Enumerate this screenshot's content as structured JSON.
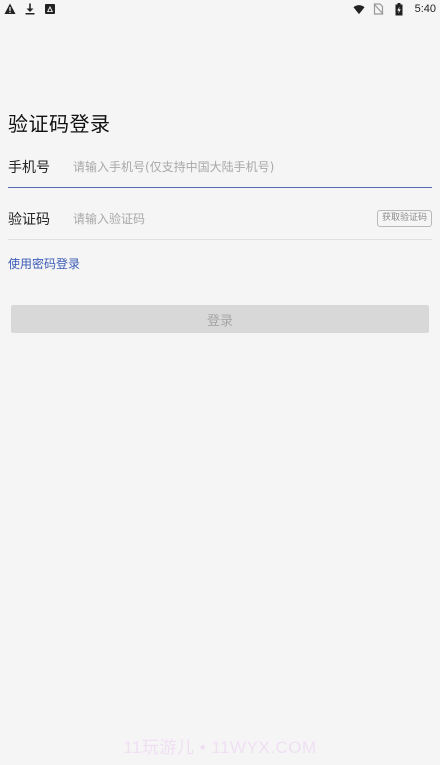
{
  "status_bar": {
    "left_icons": [
      "warning-icon",
      "download-icon",
      "app-notification-icon"
    ],
    "right_icons": [
      "wifi-icon",
      "no-sim-icon",
      "battery-icon"
    ],
    "time": "5:40"
  },
  "title": "验证码登录",
  "phone": {
    "label": "手机号",
    "placeholder": "请输入手机号(仅支持中国大陆手机号)",
    "value": ""
  },
  "code": {
    "label": "验证码",
    "placeholder": "请输入验证码",
    "value": "",
    "get_code_label": "获取验证码"
  },
  "password_login_link": "使用密码登录",
  "login_button": "登录",
  "watermark": "11玩游儿 • 11WYX.COM",
  "colors": {
    "background": "#f5f5f5",
    "link": "#3a5bb8",
    "active_underline": "#5467b0",
    "disabled_button": "#d8d8d8"
  }
}
